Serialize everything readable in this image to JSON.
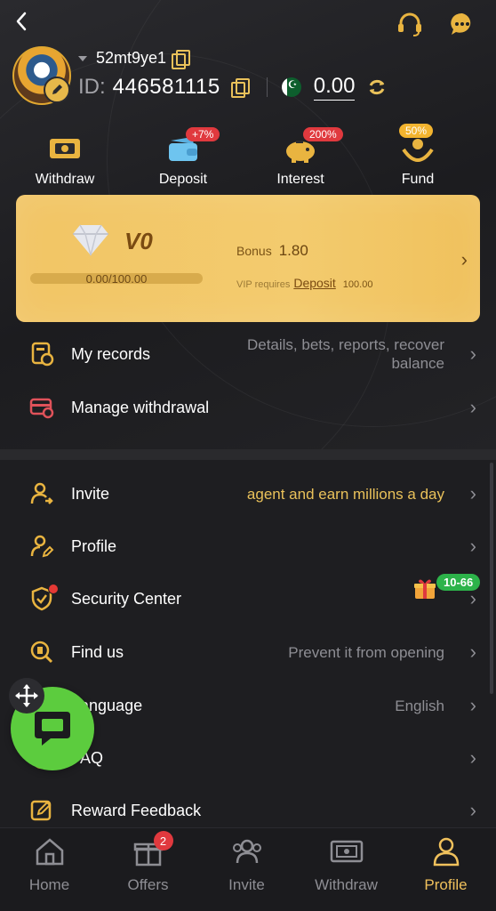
{
  "header": {
    "username": "52mt9ye1",
    "id_label": "ID:",
    "id_value": "446581115",
    "balance": "0.00"
  },
  "quick_actions": [
    {
      "label": "Withdraw",
      "badge": "",
      "icon": "ticket-icon"
    },
    {
      "label": "Deposit",
      "badge": "+7%",
      "icon": "wallet-icon"
    },
    {
      "label": "Interest",
      "badge": "200%",
      "icon": "piggy-bank-icon"
    },
    {
      "label": "Fund",
      "badge": "50%",
      "icon": "hands-coin-icon"
    }
  ],
  "vip": {
    "level": "V0",
    "progress_text": "0.00/100.00",
    "progress": 0,
    "bonus_label": "Bonus",
    "bonus_value": "1.80",
    "requires_label": "VIP requires",
    "requires_link": "Deposit",
    "requires_amount": "100.00"
  },
  "menu": {
    "records": {
      "label": "My records",
      "desc": "Details, bets, reports, recover balance"
    },
    "manage_withdrawal": {
      "label": "Manage withdrawal",
      "desc": ""
    },
    "invite": {
      "label": "Invite",
      "desc": "agent and earn millions a day"
    },
    "profile": {
      "label": "Profile",
      "desc": ""
    },
    "security": {
      "label": "Security Center",
      "badge": "10-66"
    },
    "find_us": {
      "label": "Find us",
      "desc": "Prevent it from opening"
    },
    "language": {
      "label": "Language",
      "desc": "English"
    },
    "faq": {
      "label": "FAQ",
      "desc": ""
    },
    "reward_feedback": {
      "label": "Reward Feedback",
      "desc": ""
    }
  },
  "bottom_nav": [
    {
      "label": "Home",
      "active": false
    },
    {
      "label": "Offers",
      "active": false,
      "badge": "2"
    },
    {
      "label": "Invite",
      "active": false
    },
    {
      "label": "Withdraw",
      "active": false
    },
    {
      "label": "Profile",
      "active": true
    }
  ],
  "colors": {
    "accent": "#f0c15c",
    "background": "#1f1f22",
    "vip_card": "#f2c565",
    "badge_red": "#e0393e",
    "badge_green": "#2db34a",
    "float_chat": "#5ccc3e"
  }
}
